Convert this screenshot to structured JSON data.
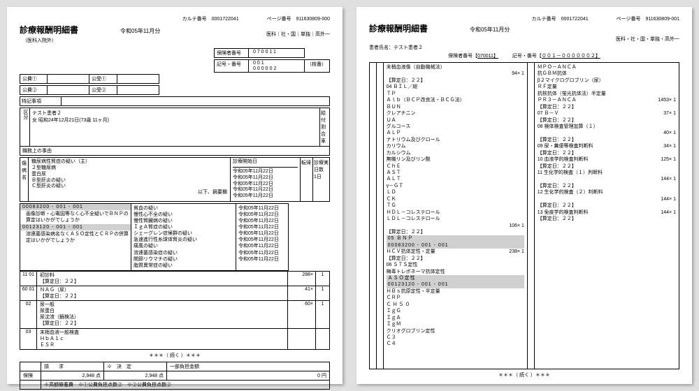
{
  "meta": {
    "karte_label": "カルテ番号",
    "karte_no": "0001722041",
    "page_label": "ページ番号",
    "page_no_1": "911630809-000",
    "page_no_2": "911630809-001",
    "title": "診療報酬明細書",
    "subtitle": "（医科入院外）",
    "month": "令和05年11月分",
    "categories": "医科｜社・国｜単独｜高外一",
    "categories2": "医科・社・国・単独・高外一"
  },
  "ins": {
    "label": "保険者番号",
    "no": "070011",
    "sym_label": "記号・番号",
    "sym1": "001",
    "sym2": "000002",
    "edaban": "（枝番）"
  },
  "pub": {
    "l1": "公費①",
    "l2": "公費②",
    "r1": "公受①",
    "r2": "公受②"
  },
  "special": "特記事項",
  "patient": {
    "seg": "区分",
    "name": "テスト患者２",
    "sex_dob": "女  昭和24年12月21日(73歳 11ヶ月)",
    "note": "職務上の事由",
    "side": "給付割合",
    "side2": "車"
  },
  "diag": {
    "label": "傷　病　名",
    "items": [
      "糖尿病性腎症の疑い（主）",
      "２型糖尿病",
      "蛋白尿",
      "Ｂ型肝炎の疑い",
      "Ｃ型肝炎の疑い"
    ],
    "etc": "以下、摘要欄",
    "onset_label": "診療開始日",
    "onsets": [
      "令和05年11月22日",
      "令和05年11月22日",
      "令和05年11月22日",
      "令和05年11月22日",
      "令和05年11月22日"
    ],
    "tenki": "転帰",
    "days_lbl": "診療実日数",
    "days": "1日"
  },
  "codes": {
    "c1": "00083200 - 001 - 001",
    "t1": "画像診断・心電図等なく心不全疑いでＢＮＰの算定はいかがでしょうか",
    "c2": "00123120 - 001 - 001",
    "t2": "溶連菌感染病名なくＡＳＯ定性とＣＲＰの併算定はいかがでしょうか"
  },
  "diag2": [
    "貧血の疑い",
    "慢性心不全の疑い",
    "慢性腎臓病の疑い",
    "ＩｇＡ腎症の疑い",
    "シェーグレン症候群の疑い",
    "急速進行性糸球体腎炎の疑い",
    "痛風の疑い",
    "溶連菌感染症の疑い",
    "関節リウマチの疑い",
    "脂質異常症の疑い"
  ],
  "diag2_dates": [
    "令和05年11月22日",
    "令和05年11月22日",
    "令和05年11月22日",
    "令和05年11月22日",
    "",
    "令和05年11月22日",
    "",
    "令和05年11月22日",
    "令和05年11月22日",
    "令和05年11月22日",
    "令和05年11月22日"
  ],
  "svc": {
    "s11": {
      "code": "11 01",
      "name": "初診料",
      "calc": "【算定日：２２】",
      "pts": "288×",
      "x": "1"
    },
    "s60": {
      "code": "60 01",
      "name": "ＮＡＧ（尿）",
      "calc": "【算定日：２２】",
      "pts": "41×",
      "x": "1"
    },
    "s02": {
      "code": "02",
      "l1": "尿一般",
      "l2": "尿蛋白",
      "l3": "尿沈渣（鏡検法）",
      "calc": "【算定日：２２】",
      "pts": "60×",
      "x": "1"
    },
    "s03": {
      "code": "03",
      "l1": "末梢血液一般検査",
      "l2": "ＨｂＡ１ｃ",
      "l3": "ＥＳＲ"
    }
  },
  "cont": "＊＊＊（ 続く ）＊＊＊",
  "foot": {
    "h1": "請　　求",
    "h2": "※　決　定",
    "h3": "一部負担金額",
    "row_lbl": "保険",
    "v1": "2,948 点",
    "v2": "2,948 点",
    "v3": "0 円",
    "note1": "※高額療養費",
    "note2": "※①公費負担点数②",
    "note3": "※②公費負担点数②"
  },
  "p2": {
    "patient_lbl": "患者氏名：",
    "patient": "テスト患者２",
    "ins_lbl": "保険者番号【",
    "ins_no": "070011】",
    "sym_lbl": "記号・番号【",
    "sym": "００１－００００００２】",
    "colL": [
      {
        "t": "  末梢血液像（自動機械法）"
      },
      {
        "t": "",
        "pts": "94×  1"
      },
      {
        "t": "  【算定日：２２】"
      },
      {
        "t": "04 ＢＩＬ／総"
      },
      {
        "t": "  ＴＰ"
      },
      {
        "t": "  Ａｌｂ（ＢＣＰ改良法・ＢＣＧ法）"
      },
      {
        "t": "  ＢＵＮ"
      },
      {
        "t": "  クレアチニン"
      },
      {
        "t": "  ＵＡ"
      },
      {
        "t": "  グルコース"
      },
      {
        "t": "  ＡＬＰ"
      },
      {
        "t": "  ナトリウム及びクロール"
      },
      {
        "t": "  カリウム"
      },
      {
        "t": "  カルシウム"
      },
      {
        "t": "  無機リン及びリン酸"
      },
      {
        "t": "  ＣｈＥ"
      },
      {
        "t": "  ＡＳＴ"
      },
      {
        "t": "  ＡＬＴ"
      },
      {
        "t": "  γ－ＧＴ"
      },
      {
        "t": "  ＬＤ"
      },
      {
        "t": "  ＣＫ"
      },
      {
        "t": "  ＴＧ"
      },
      {
        "t": "  ＨＤＬ－コレステロール"
      },
      {
        "t": "  ＬＤＬ－コレステロール"
      },
      {
        "t": "",
        "pts": "106×  1"
      },
      {
        "t": "  【算定日：２２】"
      },
      {
        "t": "05 ＢＮＰ",
        "hl": true
      },
      {
        "t": "00083200 - 001 - 001",
        "hl": true
      },
      {
        "t": "  ＨＣＶ抗体定性・定量",
        "pts": "238×  1"
      },
      {
        "t": "  【算定日：２２】"
      },
      {
        "t": "06 ＳＴＳ定性"
      },
      {
        "t": "  梅毒トレポネーマ抗体定性"
      },
      {
        "t": "  ＡＳＯ定性",
        "hl": true
      },
      {
        "t": "00123120 - 001 - 001",
        "hl": true
      },
      {
        "t": "  ＨＢｓ抗原定性・半定量"
      },
      {
        "t": "  ＣＲＰ"
      },
      {
        "t": "  Ｃ Ｈ ５ ０"
      },
      {
        "t": "  ＩｇＧ"
      },
      {
        "t": "  ＩｇＡ"
      },
      {
        "t": "  ＩｇＭ"
      },
      {
        "t": "  クリオグロブリン定性"
      },
      {
        "t": "  Ｃ３"
      },
      {
        "t": "  Ｃ４"
      }
    ],
    "colR": [
      {
        "t": "  ＭＰＯ－ＡＮＣＡ"
      },
      {
        "t": "  抗ＧＢＭ抗体"
      },
      {
        "t": "  β２マイクログロブリン（尿）"
      },
      {
        "t": "  ＲＦ定量"
      },
      {
        "t": "  抗核抗体（蛍光抗体法）半定量"
      },
      {
        "t": "  ＰＲ３－ＡＮＣＡ",
        "pts": "1453×  1"
      },
      {
        "t": "  【算定日：２２】"
      },
      {
        "t": "07 Ｂ－Ｖ",
        "pts": "37×  1"
      },
      {
        "t": "  【算定日：２２】"
      },
      {
        "t": "08 検体検査管理加算（１）"
      },
      {
        "t": "",
        "pts": "40×  1"
      },
      {
        "t": "  【算定日：２２】"
      },
      {
        "t": "09 尿・糞便等検査判断料",
        "pts": "34×  1"
      },
      {
        "t": "  【算定日：２２】"
      },
      {
        "t": "10 血液学的検査判断料",
        "pts": "125×  1"
      },
      {
        "t": "  【算定日：２２】"
      },
      {
        "t": "11 生化学的検査（１）判断料"
      },
      {
        "t": "",
        "pts": "144×  1"
      },
      {
        "t": "  【算定日：２２】"
      },
      {
        "t": "12 生化学的検査（２）判断料"
      },
      {
        "t": "",
        "pts": "144×  1"
      },
      {
        "t": "  【算定日：２２】"
      },
      {
        "t": "13 免疫学的検査判断料",
        "pts": "144×  1"
      },
      {
        "t": "  【算定日：２２】"
      }
    ]
  }
}
